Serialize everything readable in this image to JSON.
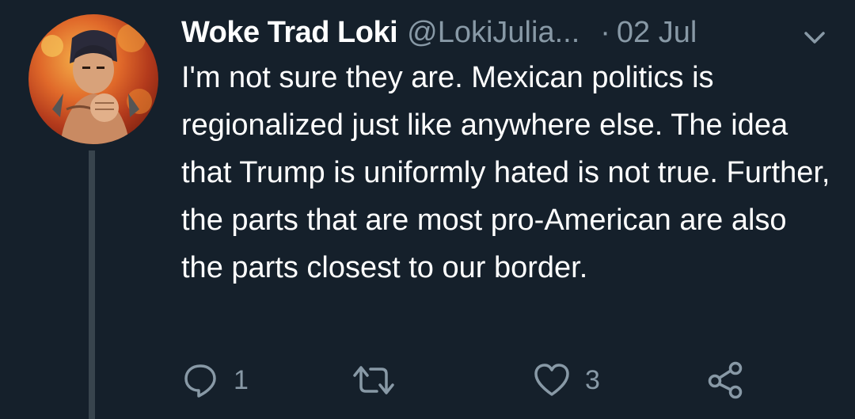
{
  "tweet": {
    "display_name": "Woke Trad Loki",
    "handle": "@LokiJulia...",
    "separator": "·",
    "date": "02 Jul",
    "text": "I'm not sure they are. Mexican politics is regionalized just like anywhere else. The idea that Trump is uniformly hated is not true. Further, the parts that are most pro-American are also the parts closest to our border."
  },
  "actions": {
    "reply_count": "1",
    "retweet_count": "",
    "like_count": "3"
  },
  "colors": {
    "background": "#15202b",
    "primary_text": "#ffffff",
    "secondary_text": "#8899a6",
    "thread_line": "#38444d"
  },
  "icons": {
    "reply": "reply-icon",
    "retweet": "retweet-icon",
    "like": "heart-icon",
    "share": "share-icon",
    "menu": "chevron-down-icon"
  }
}
